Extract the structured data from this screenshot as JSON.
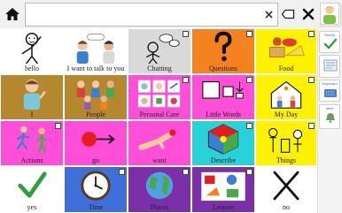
{
  "topbar": {
    "message_text": "",
    "icons": [
      "home-icon",
      "clear-icon",
      "backspace-icon",
      "close-icon"
    ]
  },
  "side_panel": [
    {
      "name": "avatar",
      "label": ""
    },
    {
      "name": "yes-no",
      "label": "Yes/No"
    },
    {
      "name": "keyboard",
      "label": "Keyboard"
    },
    {
      "name": "alerts",
      "label": "Alert"
    }
  ],
  "grid": {
    "cells": [
      {
        "label": "hello",
        "color": "#ffffff",
        "icon": "hello-icon"
      },
      {
        "label": "I want to talk to you",
        "color": "#ffffff",
        "icon": "talk-icon"
      },
      {
        "label": "Chatting",
        "color": "#d9d9d9",
        "icon": "chatting-icon"
      },
      {
        "label": "Questions",
        "color": "#f58220",
        "icon": "question-mark-icon"
      },
      {
        "label": "Food",
        "color": "#fff200",
        "icon": "food-icon"
      },
      {
        "label": "I",
        "color": "#b5882f",
        "icon": "me-icon"
      },
      {
        "label": "People",
        "color": "#b5882f",
        "icon": "people-icon"
      },
      {
        "label": "Personal Care",
        "color": "#ff4fd8",
        "icon": "personal-care-icon"
      },
      {
        "label": "Little Words",
        "color": "#ff4fd8",
        "icon": "little-words-icon"
      },
      {
        "label": "My Day",
        "color": "#fff200",
        "icon": "my-day-icon"
      },
      {
        "label": "Actions",
        "color": "#ff4fd8",
        "icon": "actions-icon"
      },
      {
        "label": "go",
        "color": "#ff4fd8",
        "icon": "go-icon"
      },
      {
        "label": "want",
        "color": "#ff4fd8",
        "icon": "want-icon"
      },
      {
        "label": "Describe",
        "color": "#27d3d9",
        "icon": "describe-icon"
      },
      {
        "label": "Things",
        "color": "#fff200",
        "icon": "things-icon"
      },
      {
        "label": "yes",
        "color": "#ffffff",
        "icon": "yes-check-icon"
      },
      {
        "label": "Time",
        "color": "#3f6fd8",
        "icon": "clock-icon"
      },
      {
        "label": "Places",
        "color": "#7b2fa8",
        "icon": "globe-icon"
      },
      {
        "label": "Leisure",
        "color": "#7b2fa8",
        "icon": "leisure-icon"
      },
      {
        "label": "no",
        "color": "#ffffff",
        "icon": "no-cross-icon"
      }
    ]
  }
}
